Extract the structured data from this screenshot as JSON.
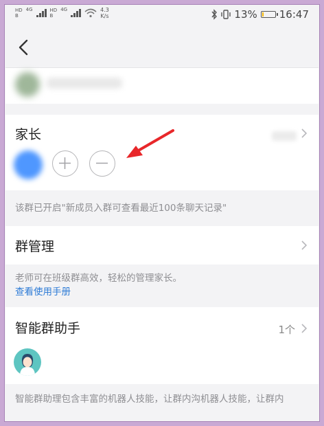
{
  "status_bar": {
    "hd_label_1": "HD",
    "hd_sub_1": "B",
    "hd_label_2": "HD",
    "hd_sub_2": "B",
    "net_1": "4G",
    "net_2": "4G",
    "speed_value": "4.3",
    "speed_unit": "K/s",
    "battery_text": "13%",
    "battery_level": 0.13,
    "time": "16:47"
  },
  "parents_section": {
    "title": "家长",
    "notice": "该群已开启\"新成员入群可查看最近100条聊天记录\""
  },
  "group_management": {
    "title": "群管理",
    "description": "老师可在班级群高效，轻松的管理家长。",
    "link_text": "查看使用手册"
  },
  "assistant_section": {
    "title": "智能群助手",
    "count": "1个",
    "description": "智能群助理包含丰富的机器人技能，让群内沟机器人技能，让群内"
  },
  "colors": {
    "link": "#2f7cd6",
    "annotation_arrow": "#e8272a",
    "battery_fill": "#f5b800",
    "bot_avatar_bg": "#5ec5c1"
  }
}
